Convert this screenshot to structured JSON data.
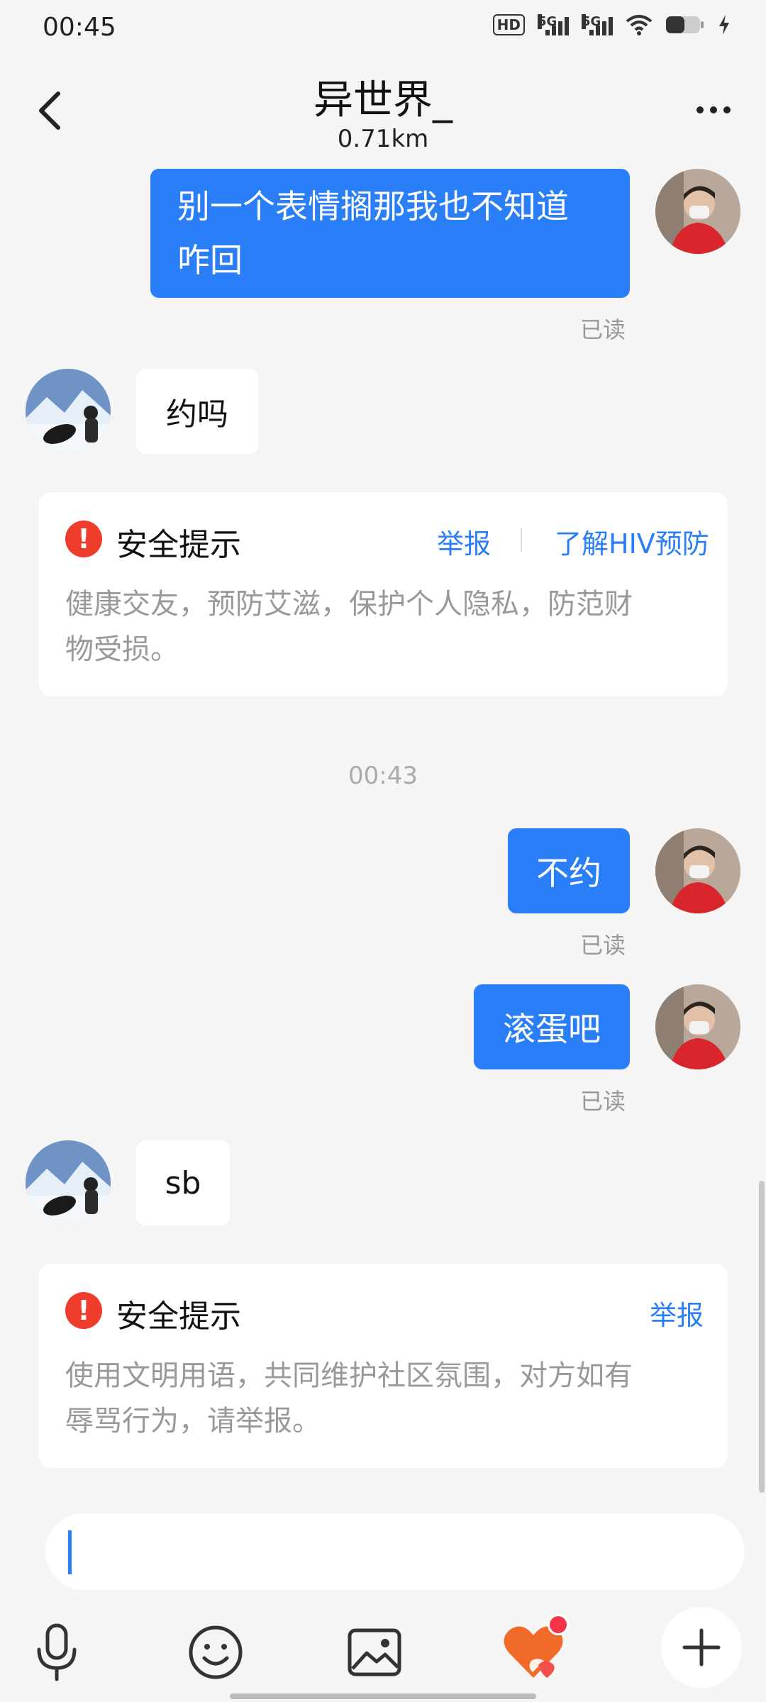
{
  "status_bar": {
    "time": "00:45",
    "hd_badge": "HD",
    "net1": "5G",
    "net2": "5G"
  },
  "header": {
    "title": "异世界_",
    "distance": "0.71km",
    "back_icon": "chevron-left-icon",
    "more_icon": "more-dots-icon"
  },
  "messages": [
    {
      "side": "out",
      "text_line1": "别一个表情搁那我也不知道",
      "text_line2": "咋回",
      "status": "已读"
    },
    {
      "side": "in",
      "text": "约吗"
    },
    {
      "side": "out",
      "text": "不约",
      "status": "已读"
    },
    {
      "side": "out",
      "text": "滚蛋吧",
      "status": "已读"
    },
    {
      "side": "in",
      "text": "sb"
    }
  ],
  "timestamp": "00:43",
  "safety_cards": [
    {
      "title": "安全提示",
      "links": [
        "举报",
        "了解HIV预防"
      ],
      "body_line1": "健康交友，预防艾滋，保护个人隐私，防范财",
      "body_line2": "物受损。"
    },
    {
      "title": "安全提示",
      "links": [
        "举报"
      ],
      "body_line1": "使用文明用语，共同维护社区氛围，对方如有",
      "body_line2": "辱骂行为，请举报。"
    }
  ],
  "toolbar": {
    "icons": [
      "microphone-icon",
      "emoji-icon",
      "image-icon",
      "heart-gift-icon",
      "plus-icon"
    ]
  },
  "colors": {
    "accent": "#2a7ef8",
    "warning": "#ef3c2d",
    "background": "#f5f5f5"
  }
}
